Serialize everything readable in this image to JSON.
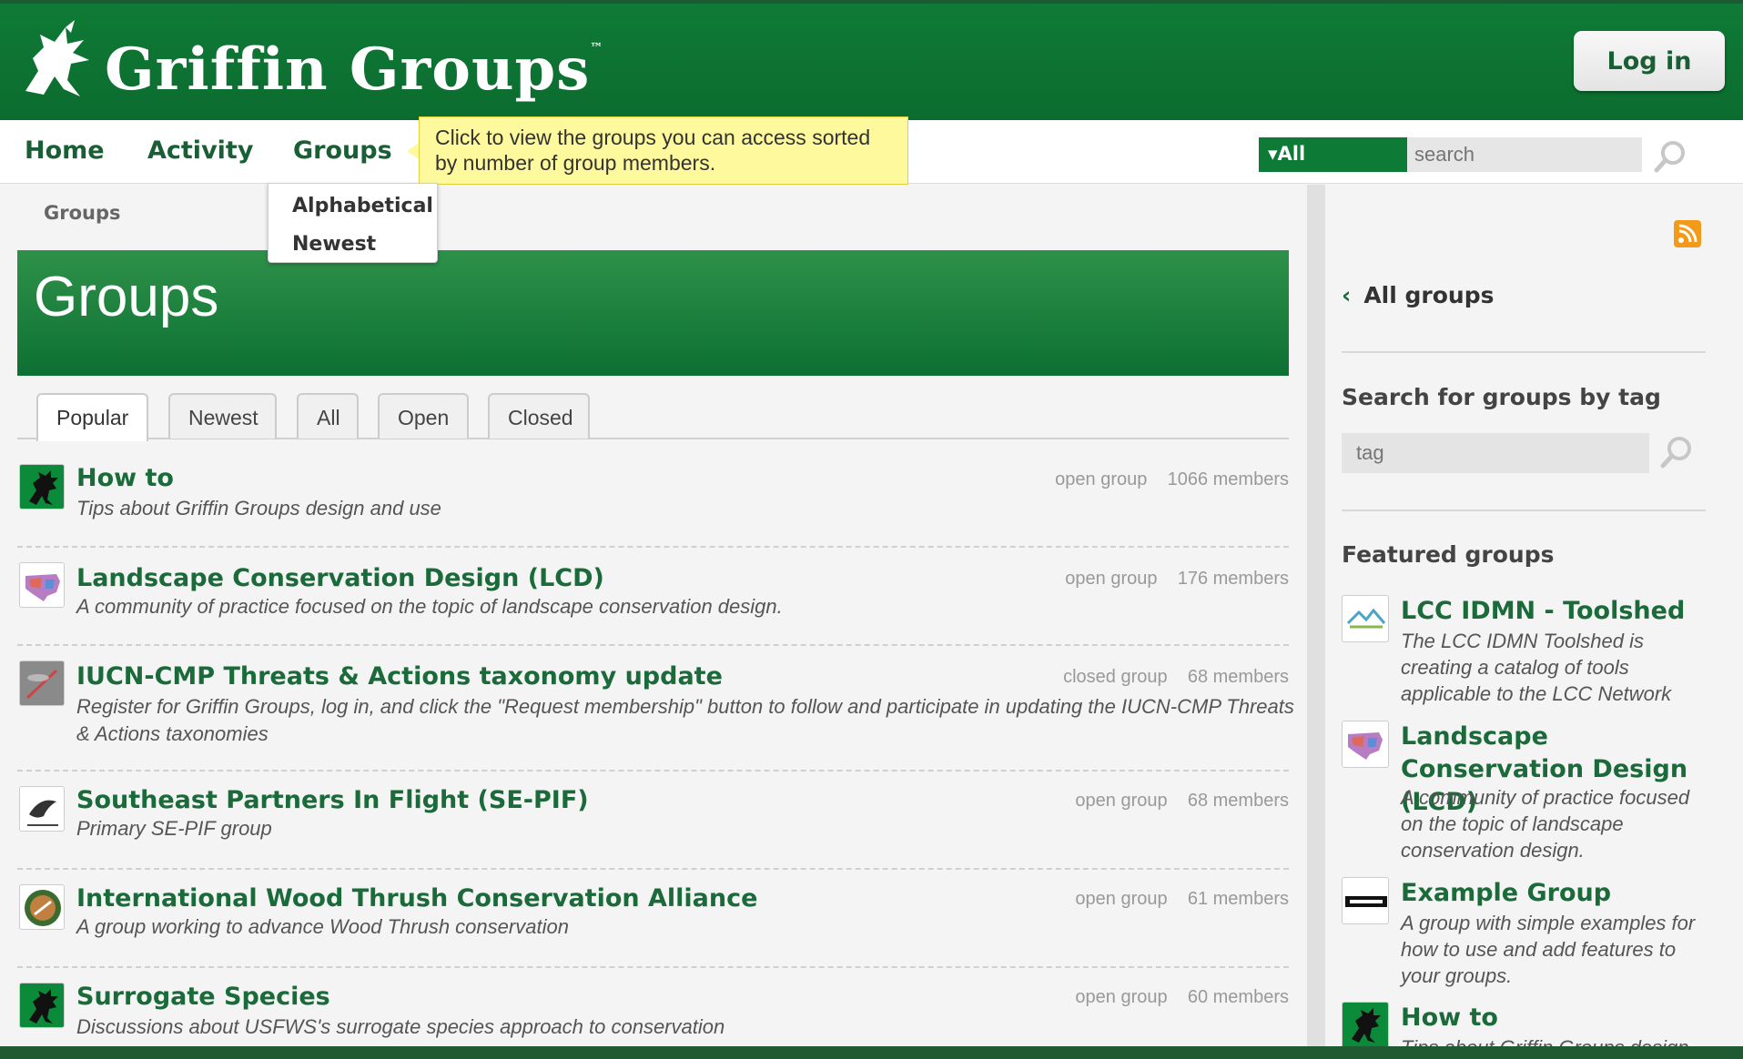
{
  "header": {
    "logo_text": "Griffin Groups",
    "logo_tm": "™",
    "login_label": "Log in"
  },
  "nav": {
    "items": [
      "Home",
      "Activity",
      "Groups"
    ],
    "tooltip": "Click to view the groups you can access sorted by number of group members.",
    "dropdown": [
      "Alphabetical",
      "Newest"
    ],
    "search_scope": "▾All",
    "search_placeholder": "search"
  },
  "main": {
    "breadcrumb": "Groups",
    "title": "Groups",
    "tabs": [
      "Popular",
      "Newest",
      "All",
      "Open",
      "Closed"
    ],
    "active_tab": "Popular",
    "groups": [
      {
        "name": "How to",
        "desc": "Tips about Griffin Groups design and use",
        "status": "open group",
        "members": "1066 members",
        "icon": "griffin-icon"
      },
      {
        "name": "Landscape Conservation Design (LCD)",
        "desc": "A community of practice focused on the topic of landscape conservation design.",
        "status": "open group",
        "members": "176 members",
        "icon": "us-map-icon"
      },
      {
        "name": "IUCN-CMP Threats & Actions taxonomy update",
        "desc": "Register for Griffin Groups, log in, and click the \"Request membership\" button to follow and participate in updating the IUCN-CMP Threats & Actions taxonomies",
        "status": "closed group",
        "members": "68 members",
        "icon": "dragonfly-icon"
      },
      {
        "name": "Southeast Partners In Flight (SE-PIF)",
        "desc": "Primary SE-PIF group",
        "status": "open group",
        "members": "68 members",
        "icon": "bird-logo-icon"
      },
      {
        "name": "International Wood Thrush Conservation Alliance",
        "desc": "A group working to advance Wood Thrush conservation",
        "status": "open group",
        "members": "61 members",
        "icon": "thrush-icon"
      },
      {
        "name": "Surrogate Species",
        "desc": "Discussions about USFWS's surrogate species approach to conservation",
        "status": "open group",
        "members": "60 members",
        "icon": "griffin-icon"
      }
    ]
  },
  "sidebar": {
    "back_label": "All groups",
    "tag_heading": "Search for groups by tag",
    "tag_placeholder": "tag",
    "featured_heading": "Featured groups",
    "featured": [
      {
        "name": "LCC IDMN - Toolshed",
        "desc": "The LCC IDMN Toolshed is creating a catalog of tools applicable to the LCC Network",
        "icon": "mountains-logo-icon"
      },
      {
        "name": "Landscape Conservation Design (LCD)",
        "desc": "A community of practice focused on the topic of landscape conservation design.",
        "icon": "us-map-icon"
      },
      {
        "name": "Example Group",
        "desc": "A group with simple examples for how to use and add features to your groups.",
        "icon": "example-badge-icon"
      },
      {
        "name": "How to",
        "desc": "Tips about Griffin Groups design",
        "icon": "griffin-icon"
      }
    ]
  },
  "colors": {
    "brand_green": "#0b6c2f",
    "link_green": "#1a6a3a",
    "tooltip_yellow": "#fff99e",
    "rss_orange": "#f49a1a"
  }
}
